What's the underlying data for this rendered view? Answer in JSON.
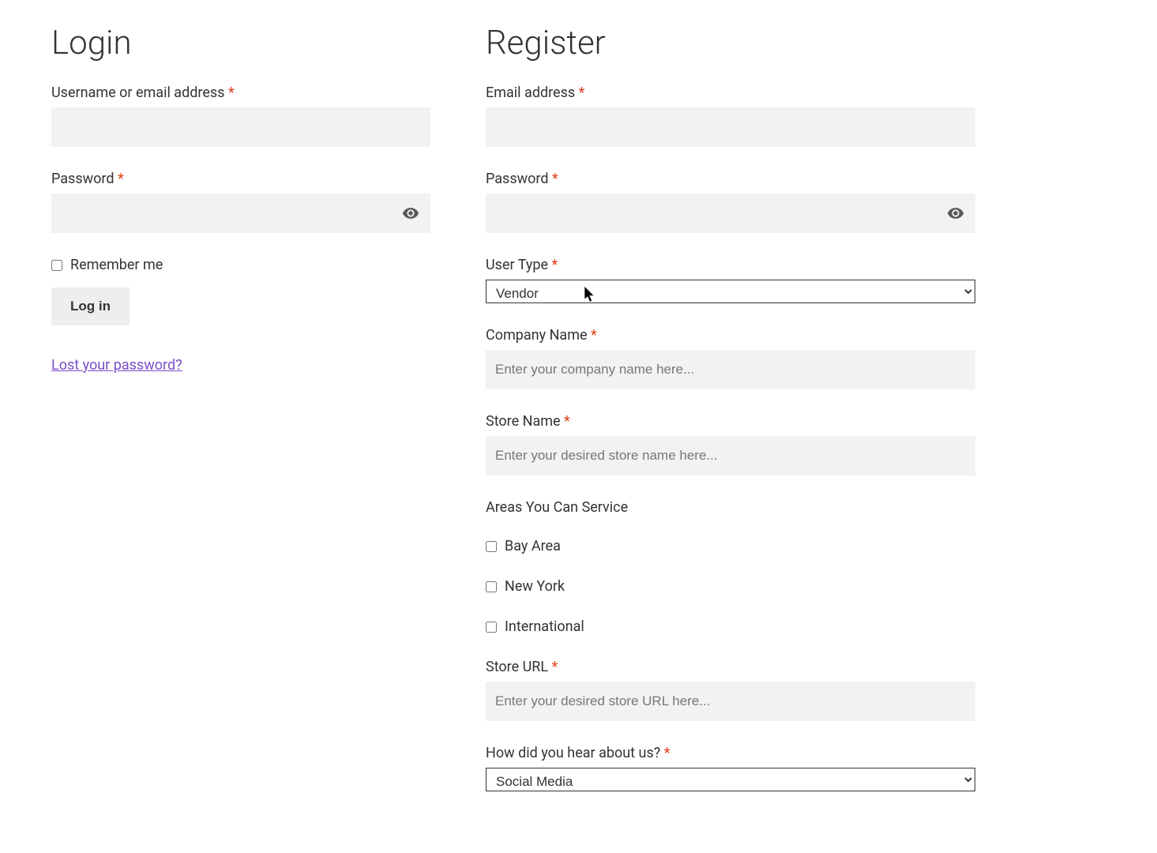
{
  "login": {
    "title": "Login",
    "username_label": "Username or email address",
    "password_label": "Password",
    "remember_label": "Remember me",
    "button_label": "Log in",
    "lost_password_label": "Lost your password?"
  },
  "register": {
    "title": "Register",
    "email_label": "Email address",
    "password_label": "Password",
    "user_type_label": "User Type",
    "user_type_value": "Vendor",
    "company_label": "Company Name",
    "company_placeholder": "Enter your company name here...",
    "store_name_label": "Store Name",
    "store_name_placeholder": "Enter your desired store name here...",
    "areas_label": "Areas You Can Service",
    "area_options": {
      "0": "Bay Area",
      "1": "New York",
      "2": "International"
    },
    "store_url_label": "Store URL",
    "store_url_placeholder": "Enter your desired store URL here...",
    "hear_about_label": "How did you hear about us?",
    "hear_about_value": "Social Media"
  },
  "required_mark": "*"
}
